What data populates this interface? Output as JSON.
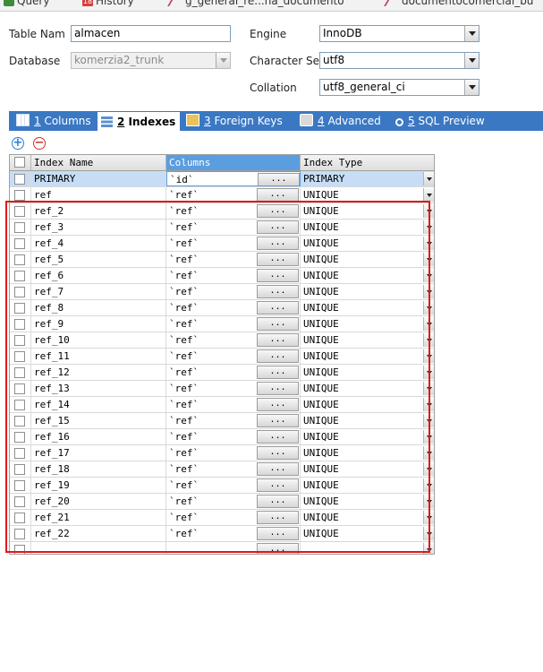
{
  "top_tabs": [
    {
      "label": "Query",
      "icon": "query-icon"
    },
    {
      "label": "History",
      "icon": "history-icon",
      "badge": "18"
    },
    {
      "label": "g_general_re...na_documento",
      "icon": "table-icon"
    },
    {
      "label": "documentocomercial_bu",
      "icon": "table-icon"
    }
  ],
  "form": {
    "table_name_label": "Table Nam",
    "table_name_value": "almacen",
    "database_label": "Database",
    "database_value": "komerzia2_trunk",
    "engine_label": "Engine",
    "engine_value": "InnoDB",
    "charset_label": "Character Se",
    "charset_value": "utf8",
    "collation_label": "Collation",
    "collation_value": "utf8_general_ci"
  },
  "tabs": [
    {
      "num": "1",
      "label": " Columns",
      "icon": "columns-icon"
    },
    {
      "num": "2",
      "label": " Indexes",
      "icon": "indexes-icon",
      "active": true
    },
    {
      "num": "3",
      "label": " Foreign Keys",
      "icon": "foreign-keys-icon"
    },
    {
      "num": "4",
      "label": " Advanced",
      "icon": "advanced-icon"
    },
    {
      "num": "5",
      "label": " SQL Preview",
      "icon": "sql-preview-icon"
    }
  ],
  "toolbar": {
    "add_icon": "add-icon",
    "remove_icon": "remove-icon"
  },
  "grid": {
    "headers": {
      "name": "Index Name",
      "columns": "Columns",
      "type": "Index Type"
    },
    "dots_label": "...",
    "rows": [
      {
        "name": "PRIMARY",
        "columns": "`id`",
        "type": "PRIMARY"
      },
      {
        "name": "ref",
        "columns": "`ref`",
        "type": "UNIQUE"
      },
      {
        "name": "ref_2",
        "columns": "`ref`",
        "type": "UNIQUE"
      },
      {
        "name": "ref_3",
        "columns": "`ref`",
        "type": "UNIQUE"
      },
      {
        "name": "ref_4",
        "columns": "`ref`",
        "type": "UNIQUE"
      },
      {
        "name": "ref_5",
        "columns": "`ref`",
        "type": "UNIQUE"
      },
      {
        "name": "ref_6",
        "columns": "`ref`",
        "type": "UNIQUE"
      },
      {
        "name": "ref_7",
        "columns": "`ref`",
        "type": "UNIQUE"
      },
      {
        "name": "ref_8",
        "columns": "`ref`",
        "type": "UNIQUE"
      },
      {
        "name": "ref_9",
        "columns": "`ref`",
        "type": "UNIQUE"
      },
      {
        "name": "ref_10",
        "columns": "`ref`",
        "type": "UNIQUE"
      },
      {
        "name": "ref_11",
        "columns": "`ref`",
        "type": "UNIQUE"
      },
      {
        "name": "ref_12",
        "columns": "`ref`",
        "type": "UNIQUE"
      },
      {
        "name": "ref_13",
        "columns": "`ref`",
        "type": "UNIQUE"
      },
      {
        "name": "ref_14",
        "columns": "`ref`",
        "type": "UNIQUE"
      },
      {
        "name": "ref_15",
        "columns": "`ref`",
        "type": "UNIQUE"
      },
      {
        "name": "ref_16",
        "columns": "`ref`",
        "type": "UNIQUE"
      },
      {
        "name": "ref_17",
        "columns": "`ref`",
        "type": "UNIQUE"
      },
      {
        "name": "ref_18",
        "columns": "`ref`",
        "type": "UNIQUE"
      },
      {
        "name": "ref_19",
        "columns": "`ref`",
        "type": "UNIQUE"
      },
      {
        "name": "ref_20",
        "columns": "`ref`",
        "type": "UNIQUE"
      },
      {
        "name": "ref_21",
        "columns": "`ref`",
        "type": "UNIQUE"
      },
      {
        "name": "ref_22",
        "columns": "`ref`",
        "type": "UNIQUE"
      },
      {
        "name": "",
        "columns": "",
        "type": ""
      }
    ]
  },
  "colors": {
    "tabbar": "#3a78c3",
    "highlight": "#e01818",
    "selected_row": "#c6ddf5"
  }
}
